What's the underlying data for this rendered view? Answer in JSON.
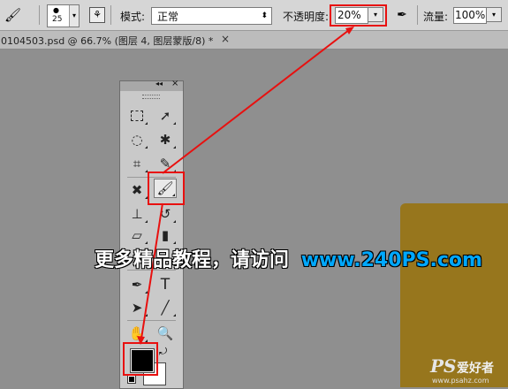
{
  "options_bar": {
    "brush_size": "25",
    "mode_label": "模式:",
    "mode_value": "正常",
    "opacity_label": "不透明度:",
    "opacity_value": "20%",
    "flow_label": "流量:",
    "flow_value": "100%"
  },
  "document_tab": {
    "title": "0104503.psd @ 66.7% (图层 4, 图层蒙版/8) *",
    "close": "×"
  },
  "tools_panel": {
    "collapse": "◂◂",
    "close": "×",
    "type_tool": "T"
  },
  "watermark": {
    "cn_text": "更多精品教程，请访问",
    "url_text": "www.240PS.com"
  },
  "logo": {
    "mark": "PS",
    "name": "爱好者",
    "url": "www.psahz.com"
  },
  "colors": {
    "highlight": "#e8100f",
    "foreground": "#000000",
    "background": "#ffffff",
    "canvas_layer": "#97761d",
    "url_text": "#00a8ff"
  }
}
